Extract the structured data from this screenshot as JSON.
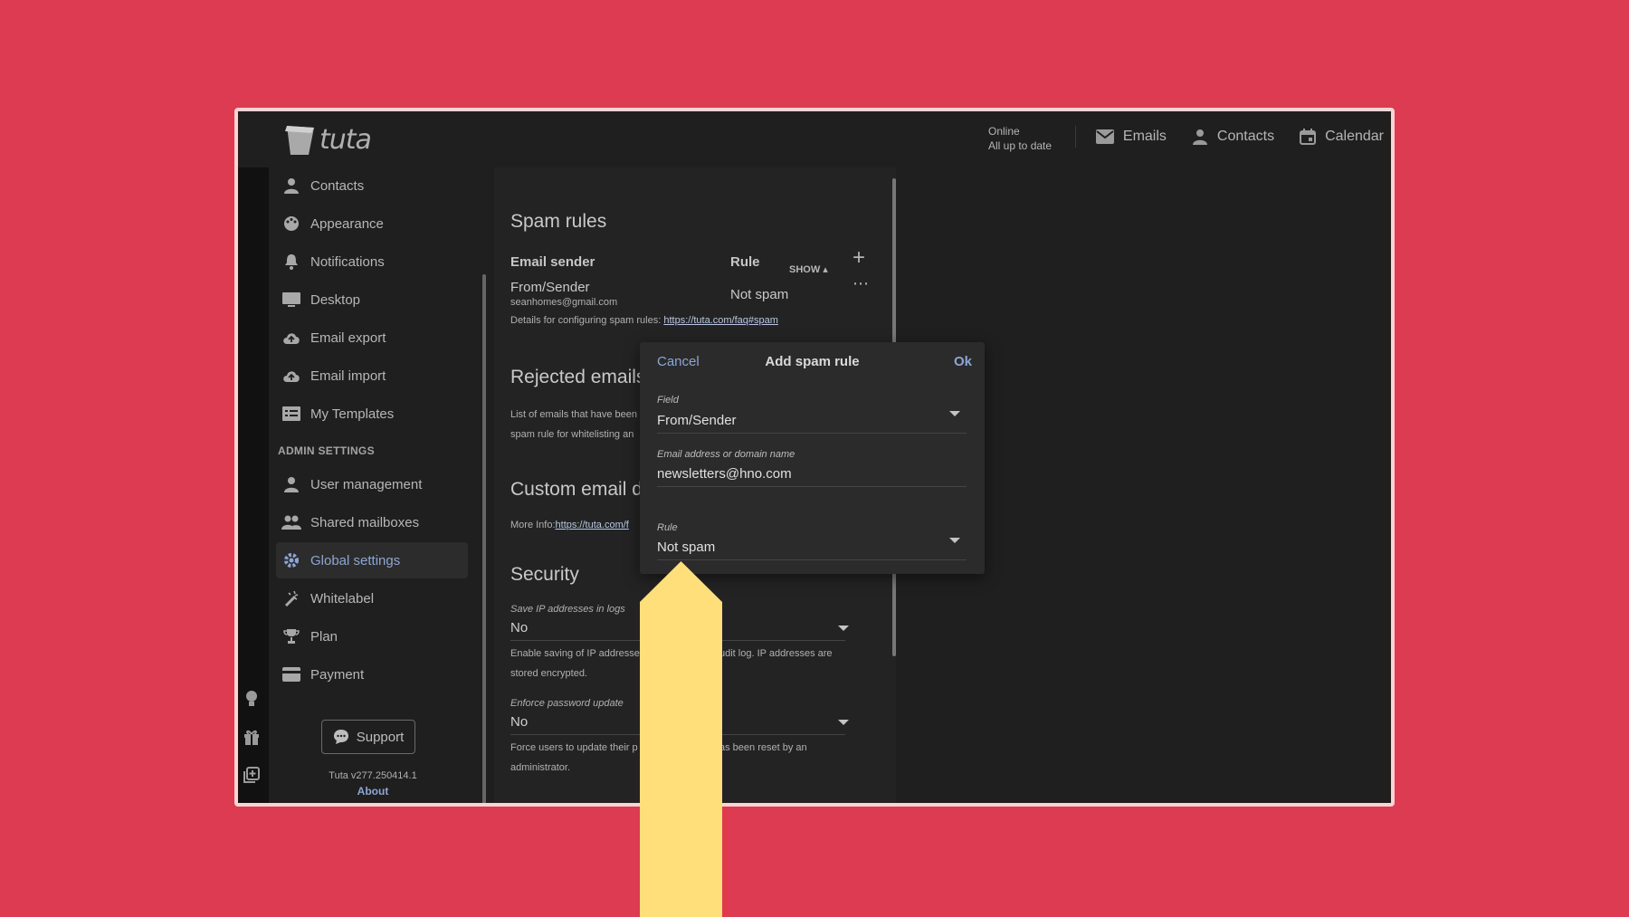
{
  "colors": {
    "background": "#dc3b51",
    "app_bg": "#1f1f1f",
    "accent": "#8ca6d6",
    "highlight_arrow": "#ffdf7a"
  },
  "header": {
    "logo_text": "tuta",
    "status_line1": "Online",
    "status_line2": "All up to date",
    "nav": [
      {
        "label": "Emails",
        "icon": "mail-icon"
      },
      {
        "label": "Contacts",
        "icon": "person-icon"
      },
      {
        "label": "Calendar",
        "icon": "calendar-icon"
      }
    ]
  },
  "rail_icons": [
    "lightbulb-icon",
    "gift-icon",
    "add-box-icon",
    "help-icon",
    "gear-icon",
    "logout-icon"
  ],
  "sidebar": {
    "items": [
      {
        "label": "Contacts",
        "icon": "person-icon"
      },
      {
        "label": "Appearance",
        "icon": "palette-icon"
      },
      {
        "label": "Notifications",
        "icon": "bell-icon"
      },
      {
        "label": "Desktop",
        "icon": "monitor-icon"
      },
      {
        "label": "Email export",
        "icon": "cloud-upload-icon"
      },
      {
        "label": "Email import",
        "icon": "cloud-download-icon"
      },
      {
        "label": "My Templates",
        "icon": "list-icon"
      }
    ],
    "admin_heading": "ADMIN SETTINGS",
    "admin_items": [
      {
        "label": "User management",
        "icon": "person-icon"
      },
      {
        "label": "Shared mailboxes",
        "icon": "people-icon"
      },
      {
        "label": "Global settings",
        "icon": "gear-icon",
        "active": true
      },
      {
        "label": "Whitelabel",
        "icon": "wand-icon"
      },
      {
        "label": "Plan",
        "icon": "trophy-icon"
      },
      {
        "label": "Payment",
        "icon": "card-icon"
      }
    ],
    "support_label": "Support",
    "version": "Tuta v277.250414.1",
    "about": "About"
  },
  "panel": {
    "spam": {
      "title": "Spam rules",
      "show_label": "SHOW",
      "col_sender": "Email sender",
      "col_rule": "Rule",
      "row_type": "From/Sender",
      "row_email": "seanhomes@gmail.com",
      "row_rule": "Not spam",
      "details_prefix": "Details for configuring spam rules: ",
      "details_link": "https://tuta.com/faq#spam"
    },
    "rejected": {
      "title": "Rejected emails",
      "desc_line1": "List of emails that have been",
      "desc_line2": "spam rule for whitelisting an"
    },
    "custom": {
      "title": "Custom email d",
      "more_prefix": "More Info:",
      "more_link": "https://tuta.com/f"
    },
    "security": {
      "title": "Security",
      "ip_label": "Save IP addresses in logs",
      "ip_value": "No",
      "ip_desc_a": "Enable saving of IP addresse",
      "ip_desc_b": "udit log. IP addresses are",
      "ip_desc_c": "stored encrypted.",
      "pw_label": "Enforce password update",
      "pw_value": "No",
      "pw_desc_a": "Force users to update their p",
      "pw_desc_b": "as been reset by an",
      "pw_desc_c": "administrator."
    }
  },
  "dialog": {
    "cancel": "Cancel",
    "title": "Add spam rule",
    "ok": "Ok",
    "field_label": "Field",
    "field_value": "From/Sender",
    "email_label": "Email address or domain name",
    "email_value": "newsletters@hno.com",
    "rule_label": "Rule",
    "rule_value": "Not spam"
  }
}
